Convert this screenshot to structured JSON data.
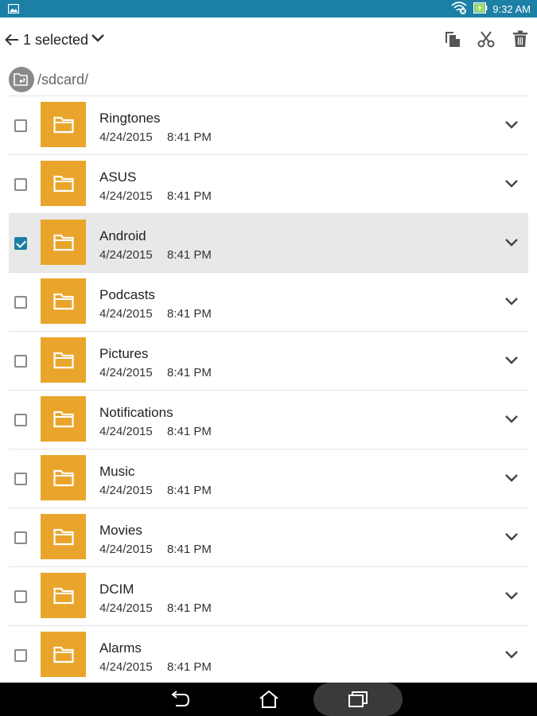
{
  "status_bar": {
    "time": "9:32 AM",
    "left_icon": "image-icon",
    "right_icons": [
      "wifi-icon",
      "battery-charging-icon"
    ]
  },
  "action_bar": {
    "selected_label": "1 selected",
    "tools": [
      "copy-icon",
      "cut-icon",
      "delete-icon"
    ]
  },
  "path_bar": {
    "path": "/sdcard/"
  },
  "files": [
    {
      "name": "Ringtones",
      "date": "4/24/2015",
      "time": "8:41 PM",
      "checked": false
    },
    {
      "name": "ASUS",
      "date": "4/24/2015",
      "time": "8:41 PM",
      "checked": false
    },
    {
      "name": "Android",
      "date": "4/24/2015",
      "time": "8:41 PM",
      "checked": true
    },
    {
      "name": "Podcasts",
      "date": "4/24/2015",
      "time": "8:41 PM",
      "checked": false
    },
    {
      "name": "Pictures",
      "date": "4/24/2015",
      "time": "8:41 PM",
      "checked": false
    },
    {
      "name": "Notifications",
      "date": "4/24/2015",
      "time": "8:41 PM",
      "checked": false
    },
    {
      "name": "Music",
      "date": "4/24/2015",
      "time": "8:41 PM",
      "checked": false
    },
    {
      "name": "Movies",
      "date": "4/24/2015",
      "time": "8:41 PM",
      "checked": false
    },
    {
      "name": "DCIM",
      "date": "4/24/2015",
      "time": "8:41 PM",
      "checked": false
    },
    {
      "name": "Alarms",
      "date": "4/24/2015",
      "time": "8:41 PM",
      "checked": false
    }
  ],
  "colors": {
    "status_bar": "#1c7fa5",
    "accent": "#1c7fa5",
    "folder": "#e9a52b",
    "selected_row": "#e8e8e8",
    "nav_bar": "#000000"
  },
  "nav_bar": {
    "buttons": [
      "back-icon",
      "home-icon",
      "recents-icon"
    ]
  }
}
